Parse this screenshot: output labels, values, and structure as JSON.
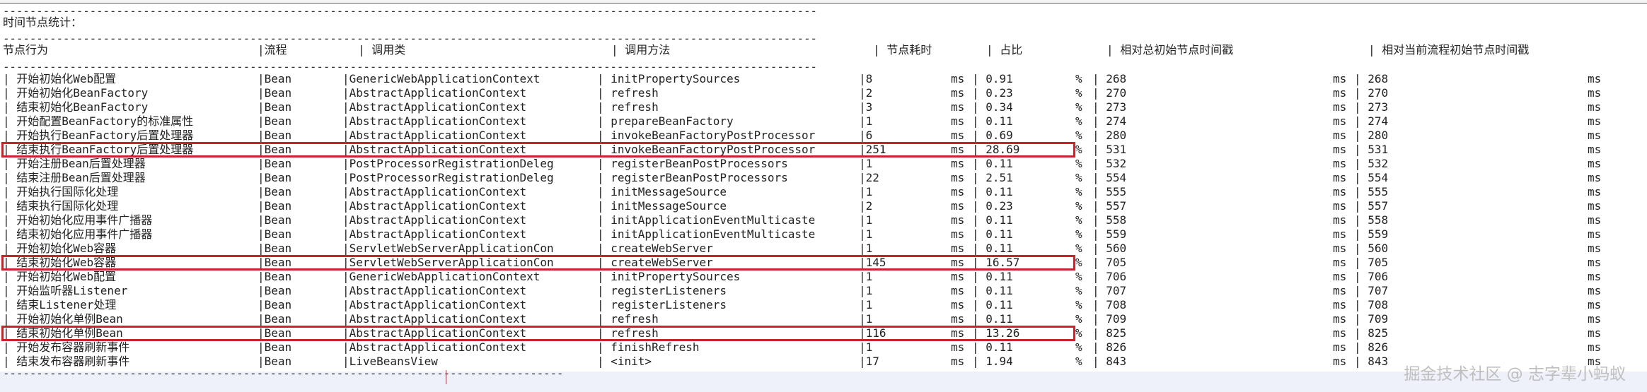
{
  "separator": "--------------------------------------------------------------------------------------------------------------------------",
  "separator_short": "------------------------------------------------------------------------------------",
  "section_title": "时间节点统计：",
  "headers": [
    "节点行为",
    "|流程",
    "| 调用类",
    "| 调用方法",
    "| 节点耗时",
    "| 占比",
    "| 相对总初始节点时间戳",
    "| 相对当前流程初始节点时间戳"
  ],
  "rows": [
    {
      "action": "| 开始初始化Web配置",
      "flow": "|Bean",
      "cls": "|GenericWebApplicationContext",
      "method": "| initPropertySources",
      "cost": "|8",
      "unit": "ms",
      "pct": "| 0.91",
      "pctsign": "%",
      "abs": "| 268",
      "abs_unit": "ms",
      "rel": "| 268",
      "rel_unit": "ms"
    },
    {
      "action": "| 开始初始化BeanFactory",
      "flow": "|Bean",
      "cls": "|AbstractApplicationContext",
      "method": "| refresh",
      "cost": "|2",
      "unit": "ms",
      "pct": "| 0.23",
      "pctsign": "%",
      "abs": "| 270",
      "abs_unit": "ms",
      "rel": "| 270",
      "rel_unit": "ms"
    },
    {
      "action": "| 结束初始化BeanFactory",
      "flow": "|Bean",
      "cls": "|AbstractApplicationContext",
      "method": "| refresh",
      "cost": "|3",
      "unit": "ms",
      "pct": "| 0.34",
      "pctsign": "%",
      "abs": "| 273",
      "abs_unit": "ms",
      "rel": "| 273",
      "rel_unit": "ms"
    },
    {
      "action": "| 开始配置BeanFactory的标准属性",
      "flow": "|Bean",
      "cls": "|AbstractApplicationContext",
      "method": "| prepareBeanFactory",
      "cost": "|1",
      "unit": "ms",
      "pct": "| 0.11",
      "pctsign": "%",
      "abs": "| 274",
      "abs_unit": "ms",
      "rel": "| 274",
      "rel_unit": "ms"
    },
    {
      "action": "| 开始执行BeanFactory后置处理器",
      "flow": "|Bean",
      "cls": "|AbstractApplicationContext",
      "method": "| invokeBeanFactoryPostProcessor",
      "cost": "|6",
      "unit": "ms",
      "pct": "| 0.69",
      "pctsign": "%",
      "abs": "| 280",
      "abs_unit": "ms",
      "rel": "| 280",
      "rel_unit": "ms"
    },
    {
      "action": "| 结束执行BeanFactory后置处理器",
      "flow": "|Bean",
      "cls": "|AbstractApplicationContext",
      "method": "| invokeBeanFactoryPostProcessor",
      "cost": "|251",
      "unit": "ms",
      "pct": "| 28.69",
      "pctsign": "%",
      "abs": "| 531",
      "abs_unit": "ms",
      "rel": "| 531",
      "rel_unit": "ms"
    },
    {
      "action": "| 开始注册Bean后置处理器",
      "flow": "|Bean",
      "cls": "|PostProcessorRegistrationDeleg",
      "method": "| registerBeanPostProcessors",
      "cost": "|1",
      "unit": "ms",
      "pct": "| 0.11",
      "pctsign": "%",
      "abs": "| 532",
      "abs_unit": "ms",
      "rel": "| 532",
      "rel_unit": "ms"
    },
    {
      "action": "| 结束注册Bean后置处理器",
      "flow": "|Bean",
      "cls": "|PostProcessorRegistrationDeleg",
      "method": "| registerBeanPostProcessors",
      "cost": "|22",
      "unit": "ms",
      "pct": "| 2.51",
      "pctsign": "%",
      "abs": "| 554",
      "abs_unit": "ms",
      "rel": "| 554",
      "rel_unit": "ms"
    },
    {
      "action": "| 开始执行国际化处理",
      "flow": "|Bean",
      "cls": "|AbstractApplicationContext",
      "method": "| initMessageSource",
      "cost": "|1",
      "unit": "ms",
      "pct": "| 0.11",
      "pctsign": "%",
      "abs": "| 555",
      "abs_unit": "ms",
      "rel": "| 555",
      "rel_unit": "ms"
    },
    {
      "action": "| 结束执行国际化处理",
      "flow": "|Bean",
      "cls": "|AbstractApplicationContext",
      "method": "| initMessageSource",
      "cost": "|2",
      "unit": "ms",
      "pct": "| 0.23",
      "pctsign": "%",
      "abs": "| 557",
      "abs_unit": "ms",
      "rel": "| 557",
      "rel_unit": "ms"
    },
    {
      "action": "| 开始初始化应用事件广播器",
      "flow": "|Bean",
      "cls": "|AbstractApplicationContext",
      "method": "| initApplicationEventMulticaste",
      "cost": "|1",
      "unit": "ms",
      "pct": "| 0.11",
      "pctsign": "%",
      "abs": "| 558",
      "abs_unit": "ms",
      "rel": "| 558",
      "rel_unit": "ms"
    },
    {
      "action": "| 结束初始化应用事件广播器",
      "flow": "|Bean",
      "cls": "|AbstractApplicationContext",
      "method": "| initApplicationEventMulticaste",
      "cost": "|1",
      "unit": "ms",
      "pct": "| 0.11",
      "pctsign": "%",
      "abs": "| 559",
      "abs_unit": "ms",
      "rel": "| 559",
      "rel_unit": "ms"
    },
    {
      "action": "| 开始初始化Web容器",
      "flow": "|Bean",
      "cls": "|ServletWebServerApplicationCon",
      "method": "| createWebServer",
      "cost": "|1",
      "unit": "ms",
      "pct": "| 0.11",
      "pctsign": "%",
      "abs": "| 560",
      "abs_unit": "ms",
      "rel": "| 560",
      "rel_unit": "ms"
    },
    {
      "action": "| 结束初始化Web容器",
      "flow": "|Bean",
      "cls": "|ServletWebServerApplicationCon",
      "method": "| createWebServer",
      "cost": "|145",
      "unit": "ms",
      "pct": "| 16.57",
      "pctsign": "%",
      "abs": "| 705",
      "abs_unit": "ms",
      "rel": "| 705",
      "rel_unit": "ms"
    },
    {
      "action": "| 开始初始化Web配置",
      "flow": "|Bean",
      "cls": "|GenericWebApplicationContext",
      "method": "| initPropertySources",
      "cost": "|1",
      "unit": "ms",
      "pct": "| 0.11",
      "pctsign": "%",
      "abs": "| 706",
      "abs_unit": "ms",
      "rel": "| 706",
      "rel_unit": "ms"
    },
    {
      "action": "| 开始监听器Listener",
      "flow": "|Bean",
      "cls": "|AbstractApplicationContext",
      "method": "| registerListeners",
      "cost": "|1",
      "unit": "ms",
      "pct": "| 0.11",
      "pctsign": "%",
      "abs": "| 707",
      "abs_unit": "ms",
      "rel": "| 707",
      "rel_unit": "ms"
    },
    {
      "action": "| 结束Listener处理",
      "flow": "|Bean",
      "cls": "|AbstractApplicationContext",
      "method": "| registerListeners",
      "cost": "|1",
      "unit": "ms",
      "pct": "| 0.11",
      "pctsign": "%",
      "abs": "| 708",
      "abs_unit": "ms",
      "rel": "| 708",
      "rel_unit": "ms"
    },
    {
      "action": "| 开始初始化单例Bean",
      "flow": "|Bean",
      "cls": "|AbstractApplicationContext",
      "method": "| refresh",
      "cost": "|1",
      "unit": "ms",
      "pct": "| 0.11",
      "pctsign": "%",
      "abs": "| 709",
      "abs_unit": "ms",
      "rel": "| 709",
      "rel_unit": "ms"
    },
    {
      "action": "| 结束初始化单例Bean",
      "flow": "|Bean",
      "cls": "|AbstractApplicationContext",
      "method": "| refresh",
      "cost": "|116",
      "unit": "ms",
      "pct": "| 13.26",
      "pctsign": "%",
      "abs": "| 825",
      "abs_unit": "ms",
      "rel": "| 825",
      "rel_unit": "ms"
    },
    {
      "action": "| 开始发布容器刷新事件",
      "flow": "|Bean",
      "cls": "|AbstractApplicationContext",
      "method": "| finishRefresh",
      "cost": "|1",
      "unit": "ms",
      "pct": "| 0.11",
      "pctsign": "%",
      "abs": "| 826",
      "abs_unit": "ms",
      "rel": "| 826",
      "rel_unit": "ms"
    },
    {
      "action": "| 结束发布容器刷新事件",
      "flow": "|Bean",
      "cls": "|LiveBeansView",
      "method": "| <init>",
      "cost": "|17",
      "unit": "ms",
      "pct": "| 1.94",
      "pctsign": "%",
      "abs": "| 843",
      "abs_unit": "ms",
      "rel": "| 843",
      "rel_unit": "ms"
    }
  ],
  "highlight_rows": [
    5,
    13,
    18
  ],
  "highlight_color": "#c9242b",
  "watermark": "掘金技术社区 @ 志字辈小蚂蚁"
}
